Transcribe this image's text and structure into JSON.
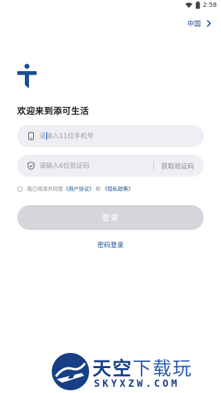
{
  "status_bar": {
    "time": "2:58"
  },
  "header": {
    "region_label": "中国"
  },
  "welcome": {
    "title": "欢迎来到添可生活"
  },
  "phone_field": {
    "placeholder": "请输入11位手机号"
  },
  "code_field": {
    "placeholder": "请输入6位验证码",
    "get_code_label": "获取验证码"
  },
  "agreement": {
    "prefix": "我已阅读并同意",
    "user_agreement": "《用户协议》",
    "and": "和",
    "privacy_policy": "《隐私政策》"
  },
  "login_button": {
    "label": "登录"
  },
  "password_login": {
    "label": "密码登录"
  },
  "watermark": {
    "title_part1": "天空",
    "title_part2": "下载玩",
    "domain": "SKYXZW.COM"
  },
  "colors": {
    "accent": "#1a4d8f",
    "button_disabled": "#d6d6da",
    "input_bg": "#eeeff3"
  }
}
